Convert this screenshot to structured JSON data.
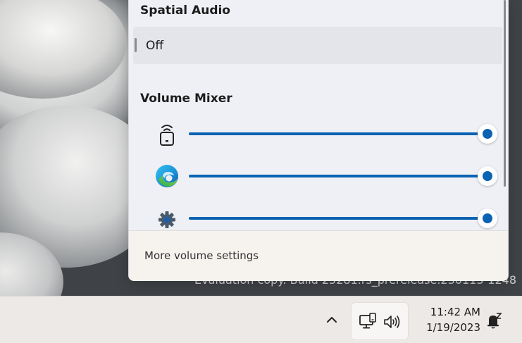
{
  "flyout": {
    "spatial_audio": {
      "title": "Spatial Audio",
      "value": "Off"
    },
    "volume_mixer": {
      "title": "Volume Mixer",
      "items": [
        {
          "icon": "remote-device-icon",
          "level": 1.0
        },
        {
          "icon": "edge-browser-icon",
          "level": 1.0
        },
        {
          "icon": "system-settings-gear-icon",
          "level": 1.0
        }
      ]
    },
    "footer_link": "More volume settings"
  },
  "desktop": {
    "watermark": "Evaluation copy. Build 25281.rs_prerelease.230113-1248"
  },
  "taskbar": {
    "time": "11:42 AM",
    "date": "1/19/2023",
    "icons": [
      "chevron-up-icon",
      "network-icon",
      "speaker-icon",
      "notification-bell-icon"
    ]
  },
  "colors": {
    "accent": "#0a63b2"
  }
}
